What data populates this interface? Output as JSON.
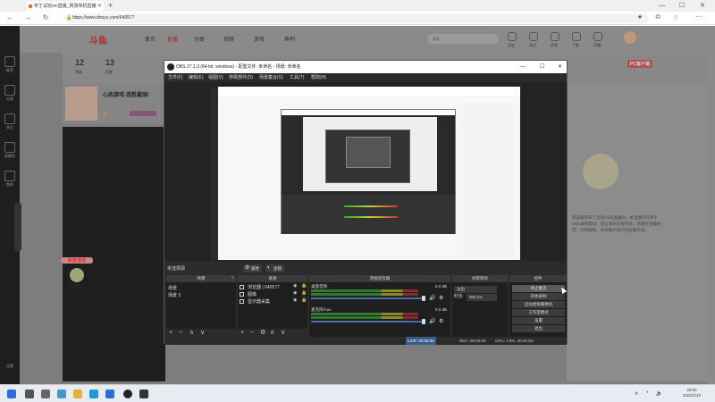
{
  "browser": {
    "tab_title": "布丁试玩mc直播_网游单机直播",
    "url": "https://www.douyu.com/640577"
  },
  "site": {
    "logo": "斗鱼",
    "nav": [
      "首页",
      "直播",
      "分类",
      "视频",
      "游戏",
      "鱼吧"
    ],
    "search_placeholder": "搜索",
    "header_icons": [
      "历史",
      "关注",
      "消息",
      "下载",
      "开播"
    ],
    "sidebar": [
      "推荐",
      "分类",
      "关注",
      "直播间",
      "鱼吧",
      "设置"
    ],
    "stats": [
      {
        "value": "12",
        "label": "等级"
      },
      {
        "value": "13",
        "label": "贡献"
      }
    ],
    "streamer_title": "心态游戏-连胜最强!",
    "right_tabs": [
      "PC客户端"
    ],
    "right_desc": "欢迎来到布丁试玩mc的直播间，本直播间仅用于OBS录制测试，禁止发布违规内容，请遵守直播规范，文明观看，共同维护良好的直播环境。",
    "gift_title": "新鱼泡泡",
    "gift_count": "0/10"
  },
  "obs": {
    "title": "OBS 27.1.3 (64-bit, windows) - 配置文件: 未命名 - 场景: 未命名",
    "menu": [
      "文件(F)",
      "编辑(E)",
      "视图(V)",
      "停靠部件(D)",
      "场景集合(S)",
      "工具(T)",
      "帮助(H)"
    ],
    "no_source": "未选择源",
    "props_btn": "属性",
    "filters_btn": "滤镜",
    "scenes": {
      "header": "场景",
      "items": [
        "场景",
        "场景 2"
      ]
    },
    "sources": {
      "header": "来源",
      "items": [
        "浏览器 | 640577",
        "图像",
        "显示器采集"
      ]
    },
    "mixer": {
      "header": "音频混音器",
      "rows": [
        {
          "name": "桌面音频",
          "db": "0.0 dB",
          "level": 0.7
        },
        {
          "name": "麦克风/Aux",
          "db": "0.0 dB",
          "level": 0.55
        }
      ]
    },
    "transitions": {
      "header": "场景转场",
      "type": "淡出",
      "duration_label": "时长",
      "duration": "300 ms"
    },
    "controls": {
      "header": "控件",
      "buttons": [
        "停止推流",
        "开始录制",
        "启动虚拟摄像机",
        "工作室模式",
        "设置",
        "退出"
      ]
    },
    "status": {
      "live": "LIVE: 00:00:00",
      "rec": "REC: 00:00:00",
      "cpu": "CPU: 1.9%, 30.00 fps"
    }
  },
  "taskbar": {
    "time": "20:02",
    "date": "2022/1/15"
  }
}
